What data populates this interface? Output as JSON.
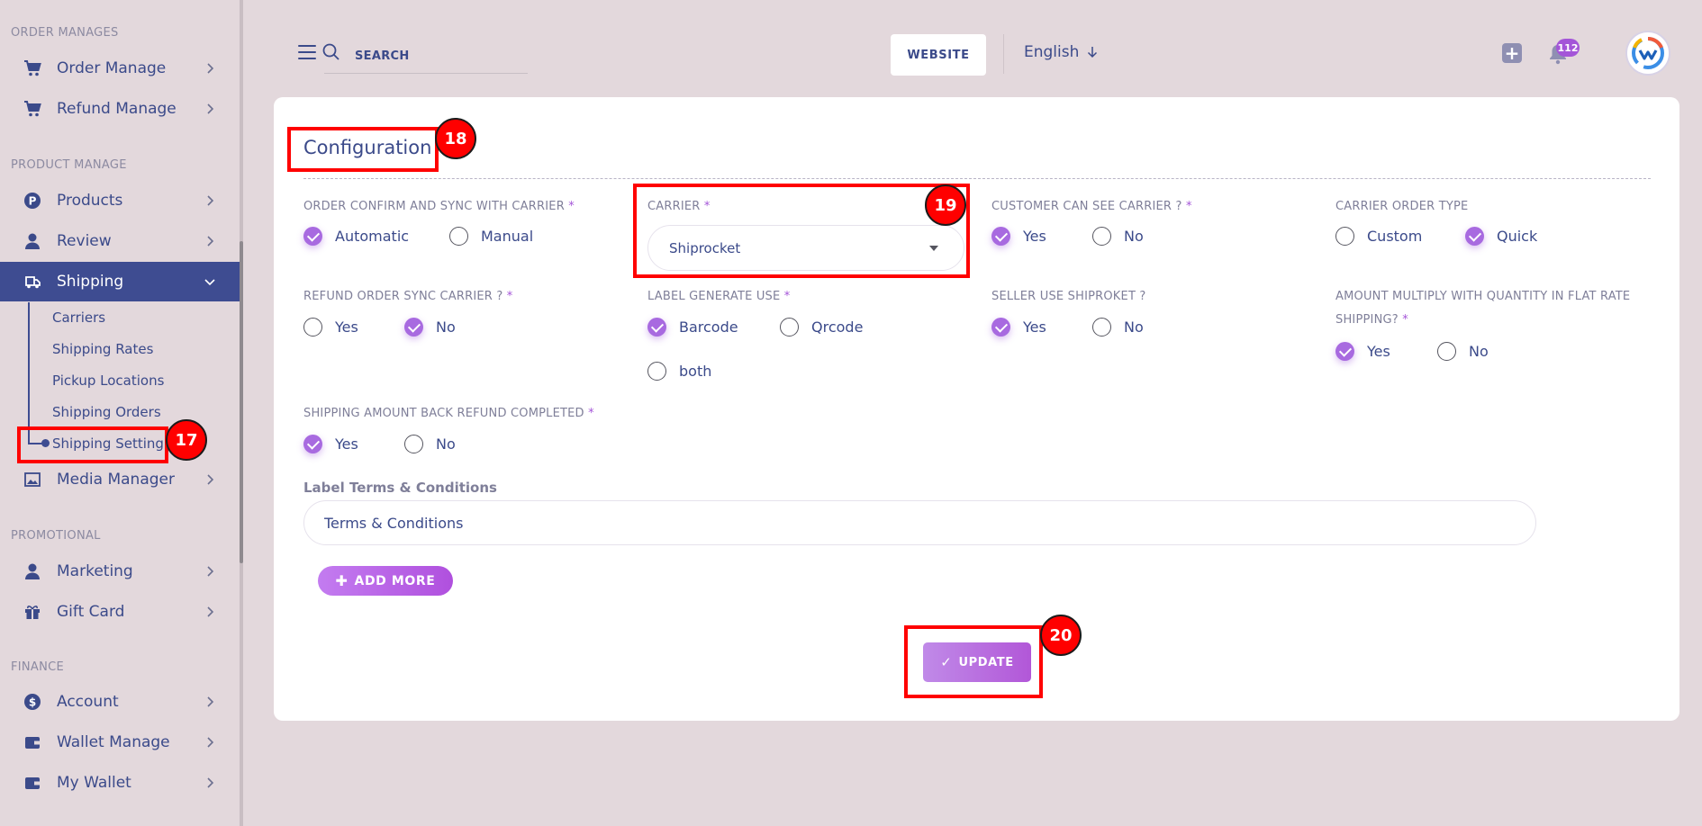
{
  "sidebar": {
    "sections": {
      "order": "ORDER MANAGES",
      "product": "PRODUCT MANAGE",
      "promotional": "PROMOTIONAL",
      "finance": "FINANCE"
    },
    "items": {
      "order_manage": "Order Manage",
      "refund_manage": "Refund Manage",
      "products": "Products",
      "review": "Review",
      "shipping": "Shipping",
      "media_manager": "Media Manager",
      "marketing": "Marketing",
      "gift_card": "Gift Card",
      "account": "Account",
      "wallet_manage": "Wallet Manage",
      "my_wallet": "My Wallet"
    },
    "shipping_sub": {
      "carriers": "Carriers",
      "shipping_rates": "Shipping Rates",
      "pickup_locations": "Pickup Locations",
      "shipping_orders": "Shipping Orders",
      "shipping_setting": "Shipping Setting"
    }
  },
  "header": {
    "search_placeholder": "SEARCH",
    "website_label": "WEBSITE",
    "language": "English",
    "notification_count": "112"
  },
  "annotations": {
    "a17": "17",
    "a18": "18",
    "a19": "19",
    "a20": "20"
  },
  "config": {
    "title": "Configuration",
    "order_confirm": {
      "label": "ORDER CONFIRM AND SYNC WITH CARRIER",
      "options": [
        "Automatic",
        "Manual"
      ],
      "selected": "Automatic"
    },
    "carrier": {
      "label": "CARRIER",
      "value": "Shiprocket"
    },
    "customer_see_carrier": {
      "label": "CUSTOMER CAN SEE CARRIER ?",
      "options": [
        "Yes",
        "No"
      ],
      "selected": "Yes"
    },
    "carrier_order_type": {
      "label": "CARRIER ORDER TYPE",
      "options": [
        "Custom",
        "Quick"
      ],
      "selected": "Quick"
    },
    "refund_sync": {
      "label": "REFUND ORDER SYNC CARRIER ?",
      "options": [
        "Yes",
        "No"
      ],
      "selected": "No"
    },
    "label_generate": {
      "label": "LABEL GENERATE USE",
      "options": [
        "Barcode",
        "Qrcode",
        "both"
      ],
      "selected": "Barcode"
    },
    "seller_use_shiproket": {
      "label": "SELLER USE SHIPROKET ?",
      "options": [
        "Yes",
        "No"
      ],
      "selected": "Yes"
    },
    "amount_multiply": {
      "label_line1": "AMOUNT MULTIPLY WITH QUANTITY IN FLAT RATE",
      "label_line2": "SHIPPING?",
      "options": [
        "Yes",
        "No"
      ],
      "selected": "Yes"
    },
    "shipping_amount_back": {
      "label": "SHIPPING AMOUNT BACK REFUND COMPLETED",
      "options": [
        "Yes",
        "No"
      ],
      "selected": "Yes"
    },
    "terms": {
      "label": "Label Terms & Conditions",
      "value": "Terms & Conditions"
    },
    "add_more_label": "ADD MORE",
    "update_label": "UPDATE",
    "required_mark": "*"
  },
  "colors": {
    "primary": "#3e4c91",
    "accent": "#a86ae0",
    "annotation": "#ff0000",
    "background": "#e3d8dc"
  }
}
